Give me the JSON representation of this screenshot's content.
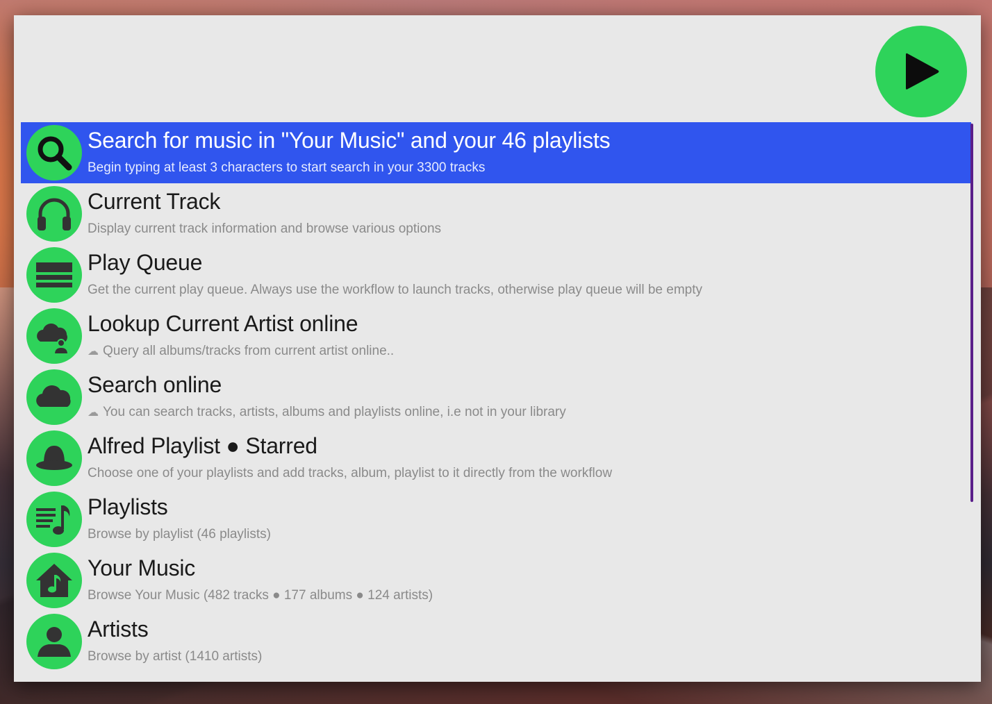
{
  "search": {
    "query": "",
    "placeholder": ""
  },
  "colors": {
    "accent_green": "#2ed35a",
    "selection_blue": "#3055ee"
  },
  "play_button": {
    "icon": "play-icon"
  },
  "results": [
    {
      "icon": "search-icon",
      "title": "Search for music in \"Your Music\" and your 46 playlists",
      "subtitle": "Begin typing at least 3 characters to start search in your 3300 tracks",
      "selected": true
    },
    {
      "icon": "headphones-icon",
      "title": "Current Track",
      "subtitle": "Display current track information and browse various options"
    },
    {
      "icon": "queue-icon",
      "title": "Play Queue",
      "subtitle": "Get the current play queue. Always use the workflow to launch tracks, otherwise play queue will be empty"
    },
    {
      "icon": "cloud-artist-icon",
      "title": "Lookup Current Artist online",
      "subtitle": "Query all albums/tracks from current artist online..",
      "subtitle_icon": "cloud-icon"
    },
    {
      "icon": "cloud-icon",
      "title": "Search online",
      "subtitle": "You can search tracks, artists, albums and playlists online, i.e not in your library",
      "subtitle_icon": "cloud-icon"
    },
    {
      "icon": "bowler-hat-icon",
      "title": "Alfred Playlist ● Starred",
      "subtitle": "Choose one of your playlists and add tracks, album, playlist to it directly from the workflow"
    },
    {
      "icon": "playlist-icon",
      "title": "Playlists",
      "subtitle": "Browse by playlist (46 playlists)"
    },
    {
      "icon": "music-house-icon",
      "title": "Your Music",
      "subtitle": "Browse Your Music (482 tracks ● 177  albums ● 124 artists)"
    },
    {
      "icon": "person-icon",
      "title": "Artists",
      "subtitle": "Browse by artist (1410 artists)"
    }
  ]
}
